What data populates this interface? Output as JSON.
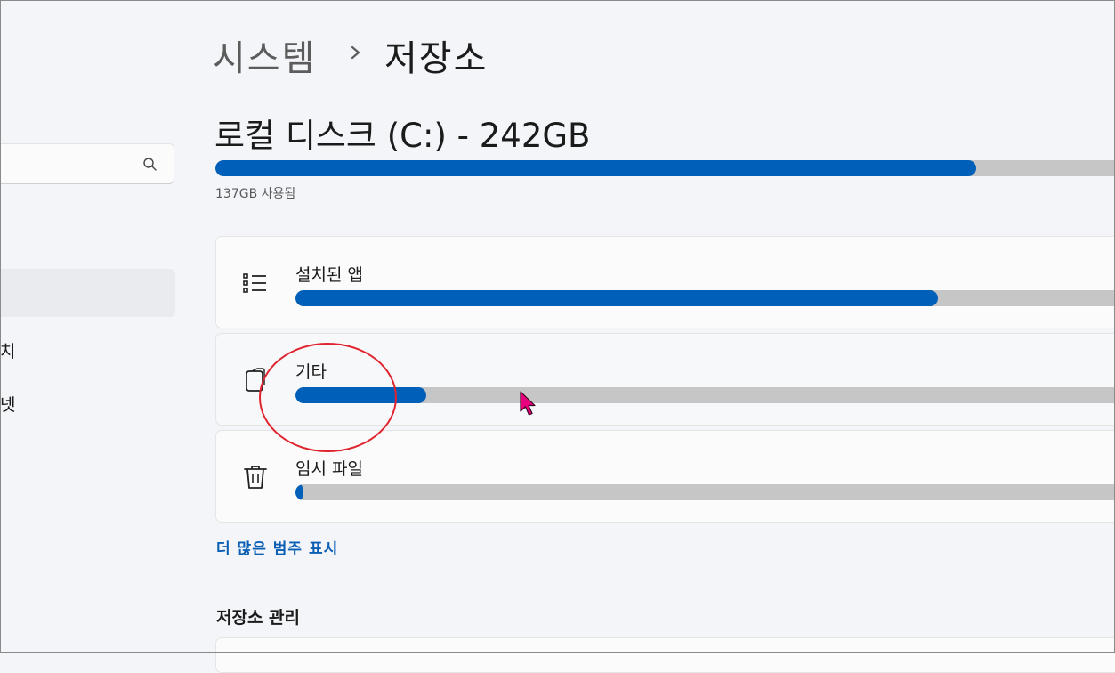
{
  "sidebar": {
    "search": {
      "placeholder": ""
    },
    "items": [
      {
        "label": "치"
      },
      {
        "label": "넷"
      }
    ]
  },
  "breadcrumb": {
    "parent": "시스템",
    "separator": "›",
    "current": "저장소"
  },
  "disk": {
    "title": "로컬 디스크 (C:) - 242GB",
    "used_label": "137GB 사용됨",
    "used_fraction": 0.83
  },
  "categories": [
    {
      "label": "설치된 앱",
      "icon": "list-icon",
      "fraction": 0.76
    },
    {
      "label": "기타",
      "icon": "document-icon",
      "fraction": 0.155
    },
    {
      "label": "임시 파일",
      "icon": "trash-icon",
      "fraction": 0.003
    }
  ],
  "more_link": "더 많은 범주 표시",
  "storage_management": {
    "title": "저장소 관리"
  },
  "colors": {
    "accent": "#005fb8",
    "bar_track": "#c6c6c6",
    "annotation": "#e0242e",
    "cursor": "#e6007e"
  }
}
